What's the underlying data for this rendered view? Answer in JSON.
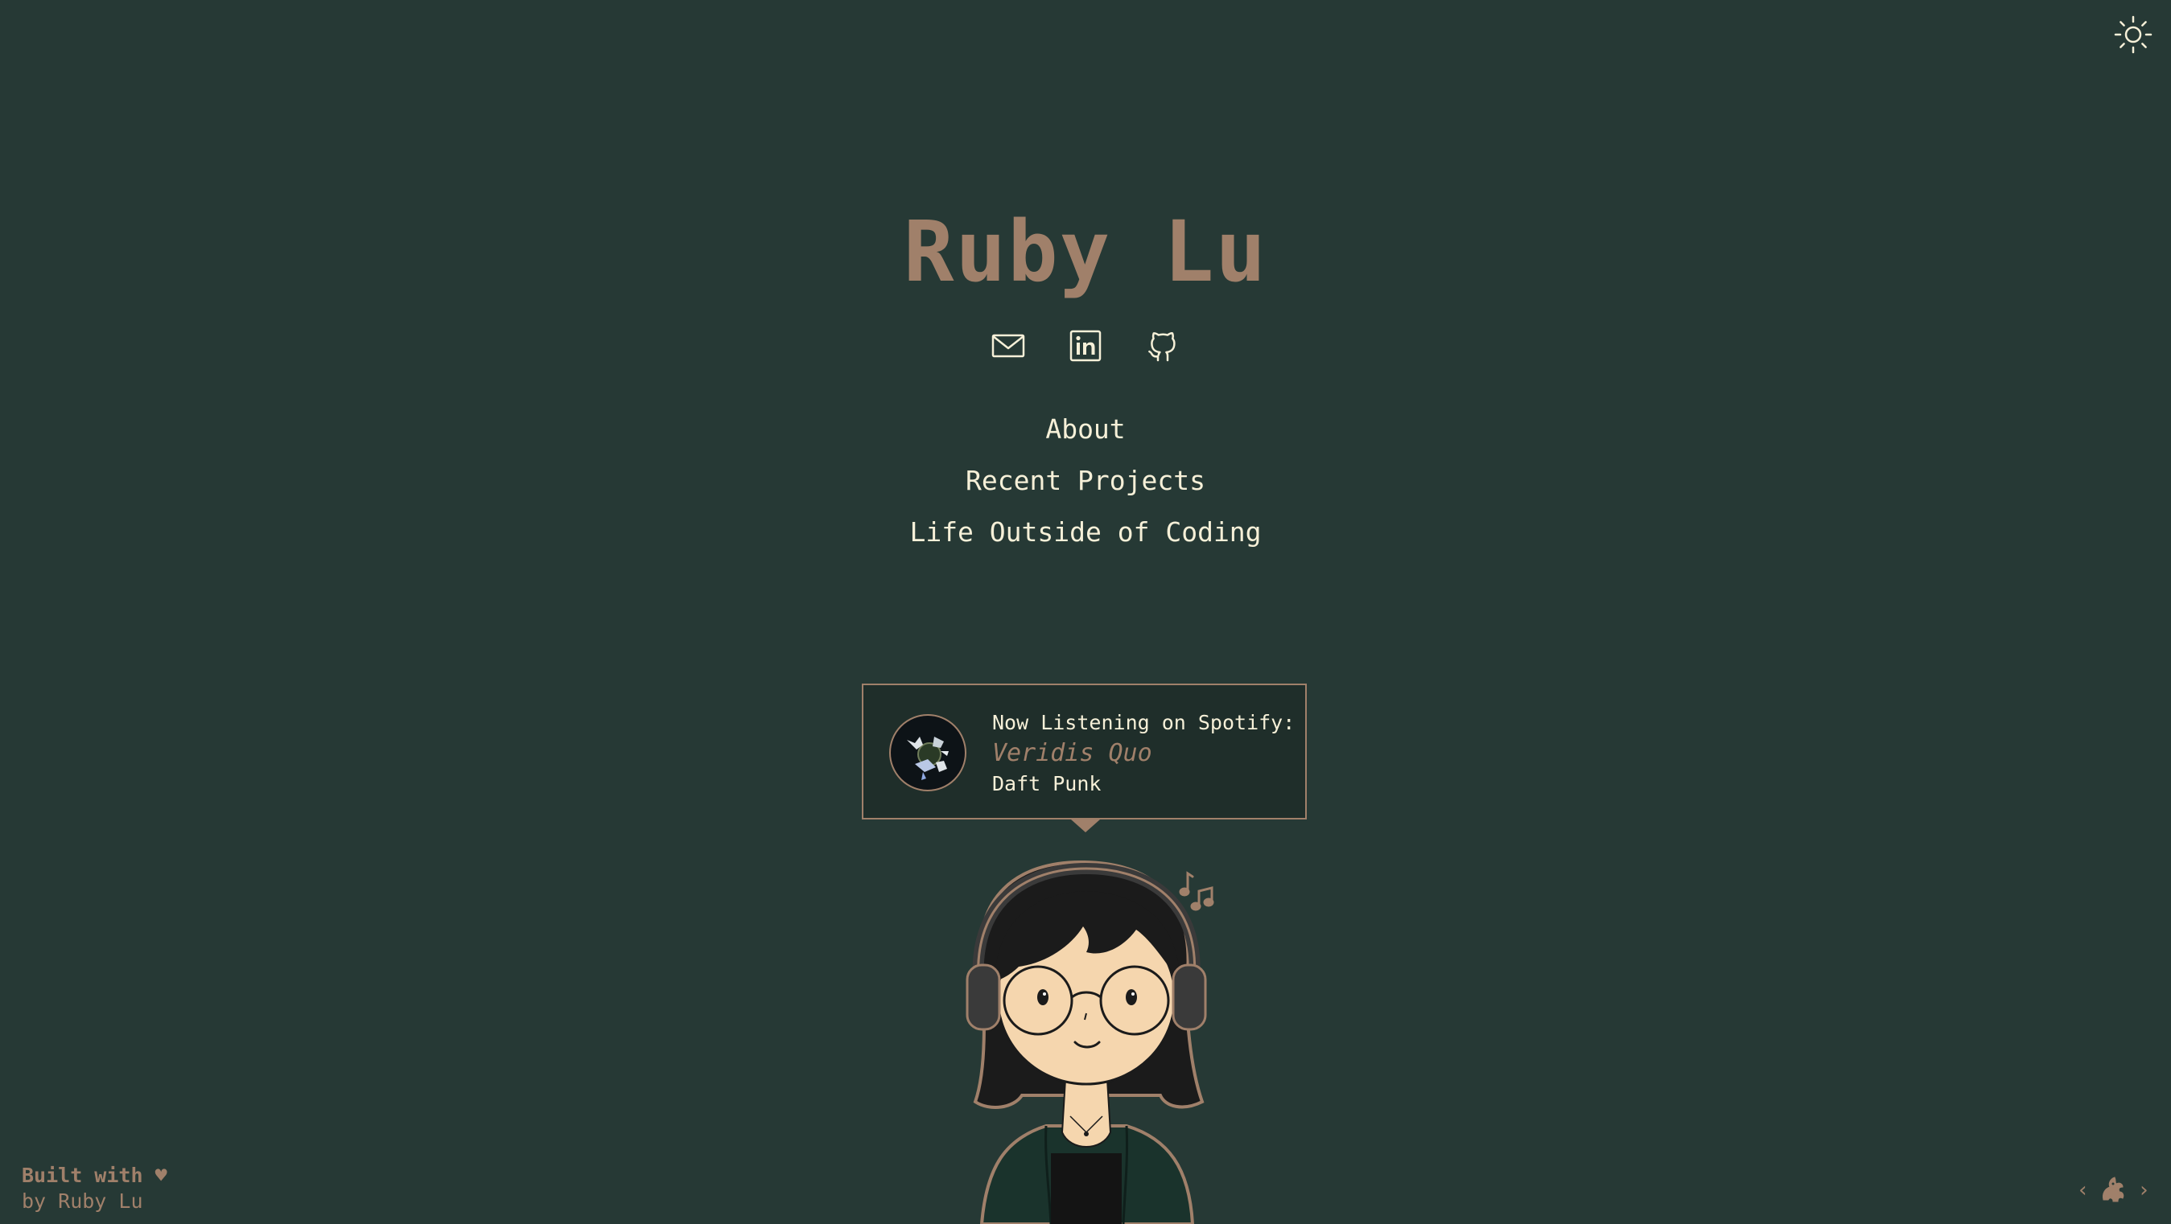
{
  "header": {
    "title": "Ruby Lu",
    "theme_toggle_icon": "sun-icon"
  },
  "social": [
    {
      "name": "email",
      "icon": "mail-icon"
    },
    {
      "name": "linkedin",
      "icon": "linkedin-icon"
    },
    {
      "name": "github",
      "icon": "github-icon"
    }
  ],
  "nav": {
    "about": "About",
    "projects": "Recent Projects",
    "life": "Life Outside of Coding"
  },
  "spotify": {
    "heading": "Now Listening on Spotify:",
    "track": "Veridis Quo",
    "artist": "Daft Punk",
    "album_icon": "album-art-icon"
  },
  "footer": {
    "built_with": "Built with ♥",
    "by": "by Ruby Lu"
  },
  "webring": {
    "prev": "‹",
    "next": "›",
    "icon": "webring-icon"
  },
  "colors": {
    "background": "#263935",
    "accent": "#a0806a",
    "text": "#f6f0d8"
  }
}
